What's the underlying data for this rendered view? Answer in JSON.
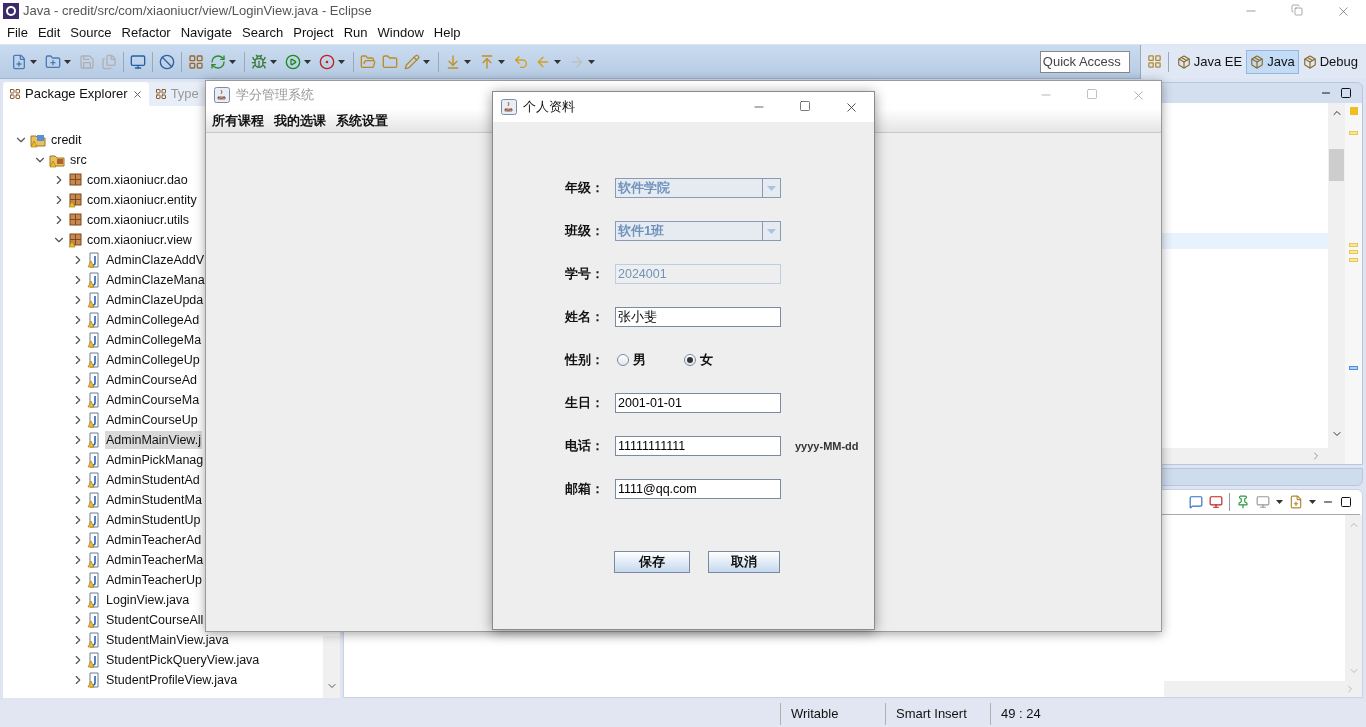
{
  "window": {
    "title": "Java - credit/src/com/xiaoniucr/view/LoginView.java - Eclipse"
  },
  "menu": [
    "File",
    "Edit",
    "Source",
    "Refactor",
    "Navigate",
    "Search",
    "Project",
    "Run",
    "Window",
    "Help"
  ],
  "quick_access": {
    "placeholder": "Quick Access"
  },
  "perspectives": [
    {
      "label": "Java EE",
      "selected": false
    },
    {
      "label": "Java",
      "selected": true
    },
    {
      "label": "Debug",
      "selected": false
    }
  ],
  "package_explorer": {
    "tabs": [
      {
        "label": "Package Explorer",
        "selected": true
      },
      {
        "label": "Type",
        "selected": false
      }
    ],
    "tree": [
      {
        "label": "credit",
        "kind": "project",
        "expanded": true,
        "selected": false,
        "children": [
          {
            "label": "src",
            "kind": "folder",
            "expanded": true,
            "selected": false,
            "children": [
              {
                "label": "com.xiaoniucr.dao",
                "kind": "package",
                "expanded": false,
                "selected": false,
                "warning": false
              },
              {
                "label": "com.xiaoniucr.entity",
                "kind": "package",
                "expanded": false,
                "selected": false,
                "warning": true
              },
              {
                "label": "com.xiaoniucr.utils",
                "kind": "package",
                "expanded": false,
                "selected": false,
                "warning": false
              },
              {
                "label": "com.xiaoniucr.view",
                "kind": "package",
                "expanded": true,
                "selected": false,
                "warning": true,
                "children": [
                  {
                    "label": "AdminClazeAddV",
                    "kind": "file",
                    "expanded": false,
                    "selected": false
                  },
                  {
                    "label": "AdminClazeMana",
                    "kind": "file",
                    "expanded": false,
                    "selected": false
                  },
                  {
                    "label": "AdminClazeUpda",
                    "kind": "file",
                    "expanded": false,
                    "selected": false
                  },
                  {
                    "label": "AdminCollegeAd",
                    "kind": "file",
                    "expanded": false,
                    "selected": false
                  },
                  {
                    "label": "AdminCollegeMa",
                    "kind": "file",
                    "expanded": false,
                    "selected": false
                  },
                  {
                    "label": "AdminCollegeUp",
                    "kind": "file",
                    "expanded": false,
                    "selected": false
                  },
                  {
                    "label": "AdminCourseAd",
                    "kind": "file",
                    "expanded": false,
                    "selected": false
                  },
                  {
                    "label": "AdminCourseMa",
                    "kind": "file",
                    "expanded": false,
                    "selected": false
                  },
                  {
                    "label": "AdminCourseUp",
                    "kind": "file",
                    "expanded": false,
                    "selected": false
                  },
                  {
                    "label": "AdminMainView.j",
                    "kind": "file",
                    "expanded": false,
                    "selected": true
                  },
                  {
                    "label": "AdminPickManag",
                    "kind": "file",
                    "expanded": false,
                    "selected": false
                  },
                  {
                    "label": "AdminStudentAd",
                    "kind": "file",
                    "expanded": false,
                    "selected": false
                  },
                  {
                    "label": "AdminStudentMa",
                    "kind": "file",
                    "expanded": false,
                    "selected": false
                  },
                  {
                    "label": "AdminStudentUp",
                    "kind": "file",
                    "expanded": false,
                    "selected": false
                  },
                  {
                    "label": "AdminTeacherAd",
                    "kind": "file",
                    "expanded": false,
                    "selected": false
                  },
                  {
                    "label": "AdminTeacherMa",
                    "kind": "file",
                    "expanded": false,
                    "selected": false
                  },
                  {
                    "label": "AdminTeacherUp",
                    "kind": "file",
                    "expanded": false,
                    "selected": false
                  },
                  {
                    "label": "LoginView.java",
                    "kind": "file",
                    "expanded": false,
                    "selected": false
                  },
                  {
                    "label": "StudentCourseAll",
                    "kind": "file",
                    "expanded": false,
                    "selected": false
                  },
                  {
                    "label": "StudentMainView.java",
                    "kind": "file",
                    "expanded": false,
                    "selected": false
                  },
                  {
                    "label": "StudentPickQueryView.java",
                    "kind": "file",
                    "expanded": false,
                    "selected": false
                  },
                  {
                    "label": "StudentProfileView.java",
                    "kind": "file",
                    "expanded": false,
                    "selected": false
                  }
                ]
              }
            ]
          }
        ]
      }
    ]
  },
  "status_bar": [
    "Writable",
    "Smart Insert",
    "49 : 24"
  ],
  "app_window": {
    "title": "学分管理系统",
    "menu": [
      "所有课程",
      "我的选课",
      "系统设置"
    ]
  },
  "dialog": {
    "title": "个人资料",
    "fields": [
      {
        "kind": "combo",
        "label": "年级：",
        "value": "软件学院",
        "disabled": true
      },
      {
        "kind": "combo",
        "label": "班级：",
        "value": "软件1班",
        "disabled": true
      },
      {
        "kind": "text",
        "label": "学号：",
        "value": "2024001",
        "disabled": true
      },
      {
        "kind": "text",
        "label": "姓名：",
        "value": "张小斐",
        "disabled": false
      },
      {
        "kind": "radio",
        "label": "性别：",
        "options": [
          {
            "label": "男",
            "selected": false
          },
          {
            "label": "女",
            "selected": true
          }
        ]
      },
      {
        "kind": "text",
        "label": "生日：",
        "value": "2001-01-01",
        "disabled": false
      },
      {
        "kind": "text",
        "label": "电话：",
        "value": "11111111111",
        "disabled": false,
        "hint": "yyyy-MM-dd"
      },
      {
        "kind": "text",
        "label": "邮箱：",
        "value": "1111@qq.com",
        "disabled": false
      }
    ],
    "buttons": [
      "保存",
      "取消"
    ]
  }
}
